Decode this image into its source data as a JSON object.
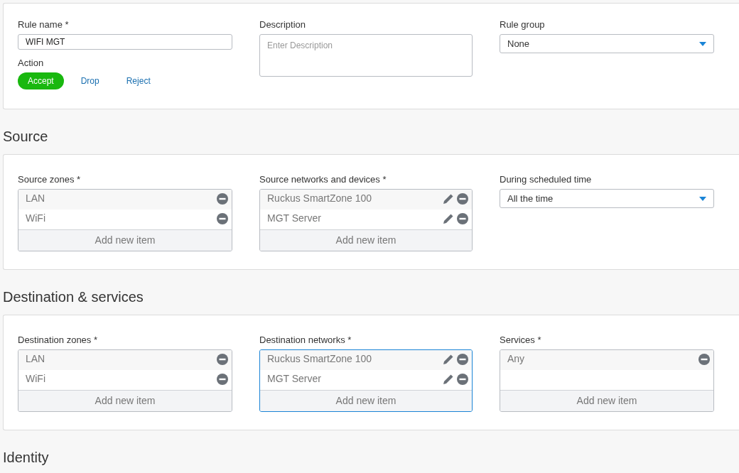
{
  "general": {
    "rule_name": {
      "label": "Rule name *",
      "value": "WIFI MGT"
    },
    "action": {
      "label": "Action",
      "options": [
        {
          "label": "Accept",
          "selected": true
        },
        {
          "label": "Drop",
          "selected": false
        },
        {
          "label": "Reject",
          "selected": false
        }
      ]
    },
    "description": {
      "label": "Description",
      "placeholder": "Enter Description"
    },
    "rule_group": {
      "label": "Rule group",
      "value": "None"
    }
  },
  "sections": [
    {
      "title": "Source",
      "fields": [
        {
          "kind": "list",
          "label": "Source zones *",
          "focused": false,
          "add_label": "Add new item",
          "items": [
            {
              "label": "LAN",
              "editable": false
            },
            {
              "label": "WiFi",
              "editable": false
            }
          ]
        },
        {
          "kind": "list",
          "label": "Source networks and devices *",
          "focused": false,
          "add_label": "Add new item",
          "items": [
            {
              "label": "Ruckus SmartZone 100",
              "editable": true
            },
            {
              "label": "MGT Server",
              "editable": true
            }
          ]
        },
        {
          "kind": "select",
          "label": "During scheduled time",
          "value": "All the time"
        }
      ]
    },
    {
      "title": "Destination & services",
      "fields": [
        {
          "kind": "list",
          "label": "Destination zones *",
          "focused": false,
          "add_label": "Add new item",
          "items": [
            {
              "label": "LAN",
              "editable": false
            },
            {
              "label": "WiFi",
              "editable": false
            }
          ]
        },
        {
          "kind": "list",
          "label": "Destination networks *",
          "focused": true,
          "add_label": "Add new item",
          "items": [
            {
              "label": "Ruckus SmartZone 100",
              "editable": true
            },
            {
              "label": "MGT Server",
              "editable": true
            }
          ]
        },
        {
          "kind": "list",
          "label": "Services *",
          "focused": false,
          "add_label": "Add new item",
          "items": [
            {
              "label": "Any",
              "editable": false
            }
          ]
        }
      ]
    },
    {
      "title": "Identity"
    }
  ]
}
